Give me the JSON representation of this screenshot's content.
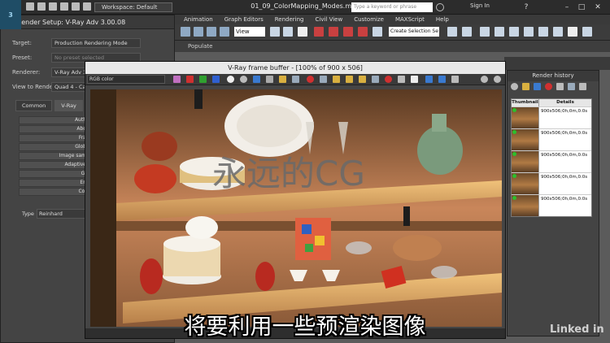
{
  "titlebar": {
    "workspace": "Workspace: Default",
    "doc_title": "01_09_ColorMapping_Modes.max",
    "search_placeholder": "Type a keyword or phrase",
    "sign_in": "Sign In",
    "help": "?"
  },
  "menu": [
    "Animation",
    "Graph Editors",
    "Rendering",
    "Civil View",
    "Customize",
    "MAXScript",
    "Help"
  ],
  "toolbar": {
    "view_select": "View",
    "selection_set": "Create Selection Se"
  },
  "populate": {
    "label": "Populate"
  },
  "render_setup": {
    "title": "Render Setup: V-Ray Adv 3.00.08",
    "target_label": "Target:",
    "target_value": "Production Rendering Mode",
    "preset_label": "Preset:",
    "preset_value": "No preset selected",
    "renderer_label": "Renderer:",
    "renderer_value": "V-Ray Adv 3.00.08",
    "view_label": "View to Render:",
    "view_value": "Quad 4 - Cam",
    "render_button": "Render",
    "tabs": [
      "Common",
      "V-Ray",
      "GI"
    ],
    "rollouts": [
      "Auth",
      "Abo",
      "Fra",
      "Glob",
      "Image sam",
      "Adaptive",
      "Gl",
      "En",
      "Col"
    ],
    "type_label": "Type",
    "type_value": "Reinhard"
  },
  "frame_buffer": {
    "title": "V-Ray frame buffer - [100% of 900 x 506]",
    "channel": "RGB color",
    "overlay_text": "永远的CG",
    "color_swatches": {
      "r": "#d03030",
      "g": "#30a030",
      "b": "#3060d0"
    }
  },
  "render_history": {
    "title": "Render history",
    "col_thumbnail": "Thumbnail",
    "col_details": "Details",
    "rows": [
      {
        "num": "1",
        "details": "900x506;0h,0m,0.0s"
      },
      {
        "num": "2",
        "details": "900x506;0h,0m,0.0s"
      },
      {
        "num": "3",
        "details": "900x506;0h,0m,0.0s"
      },
      {
        "num": "4",
        "details": "900x506;0h,0m,0.0s"
      },
      {
        "num": "5",
        "details": "900x506;0h,0m,0.0s"
      }
    ]
  },
  "subtitle": "将要利用一些预渲染图像",
  "watermark": "Linked in"
}
